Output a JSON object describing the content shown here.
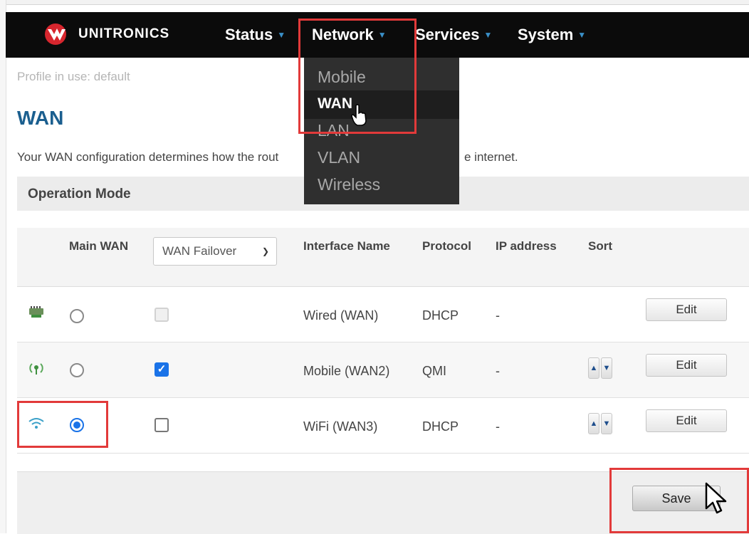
{
  "brand": {
    "name": "UNITRONICS"
  },
  "nav": [
    {
      "label": "Status"
    },
    {
      "label": "Network"
    },
    {
      "label": "Services"
    },
    {
      "label": "System"
    }
  ],
  "network_menu": {
    "items": [
      "Mobile",
      "WAN",
      "LAN",
      "VLAN",
      "Wireless"
    ]
  },
  "profile": "Profile in use: default",
  "page_title": "WAN",
  "description": {
    "left": "Your WAN configuration determines how the rout",
    "right": "e internet."
  },
  "section_title": "Operation Mode",
  "table": {
    "headers": {
      "main_wan": "Main WAN",
      "interface": "Interface Name",
      "protocol": "Protocol",
      "ip": "IP address",
      "sort": "Sort"
    },
    "mode_select": "WAN Failover",
    "rows": [
      {
        "icon": "ethernet-icon",
        "main": false,
        "failover": "disabled",
        "name": "Wired (WAN)",
        "protocol": "DHCP",
        "ip": "-",
        "edit": "Edit"
      },
      {
        "icon": "mobile-antenna-icon",
        "main": false,
        "failover": "checked",
        "name": "Mobile (WAN2)",
        "protocol": "QMI",
        "ip": "-",
        "edit": "Edit"
      },
      {
        "icon": "wifi-icon",
        "main": true,
        "failover": "unchecked",
        "name": "WiFi (WAN3)",
        "protocol": "DHCP",
        "ip": "-",
        "edit": "Edit"
      }
    ]
  },
  "save_label": "Save",
  "colors": {
    "title_blue": "#1b5f8f",
    "accent": "#1a73e8",
    "highlight": "#e23a3a"
  }
}
